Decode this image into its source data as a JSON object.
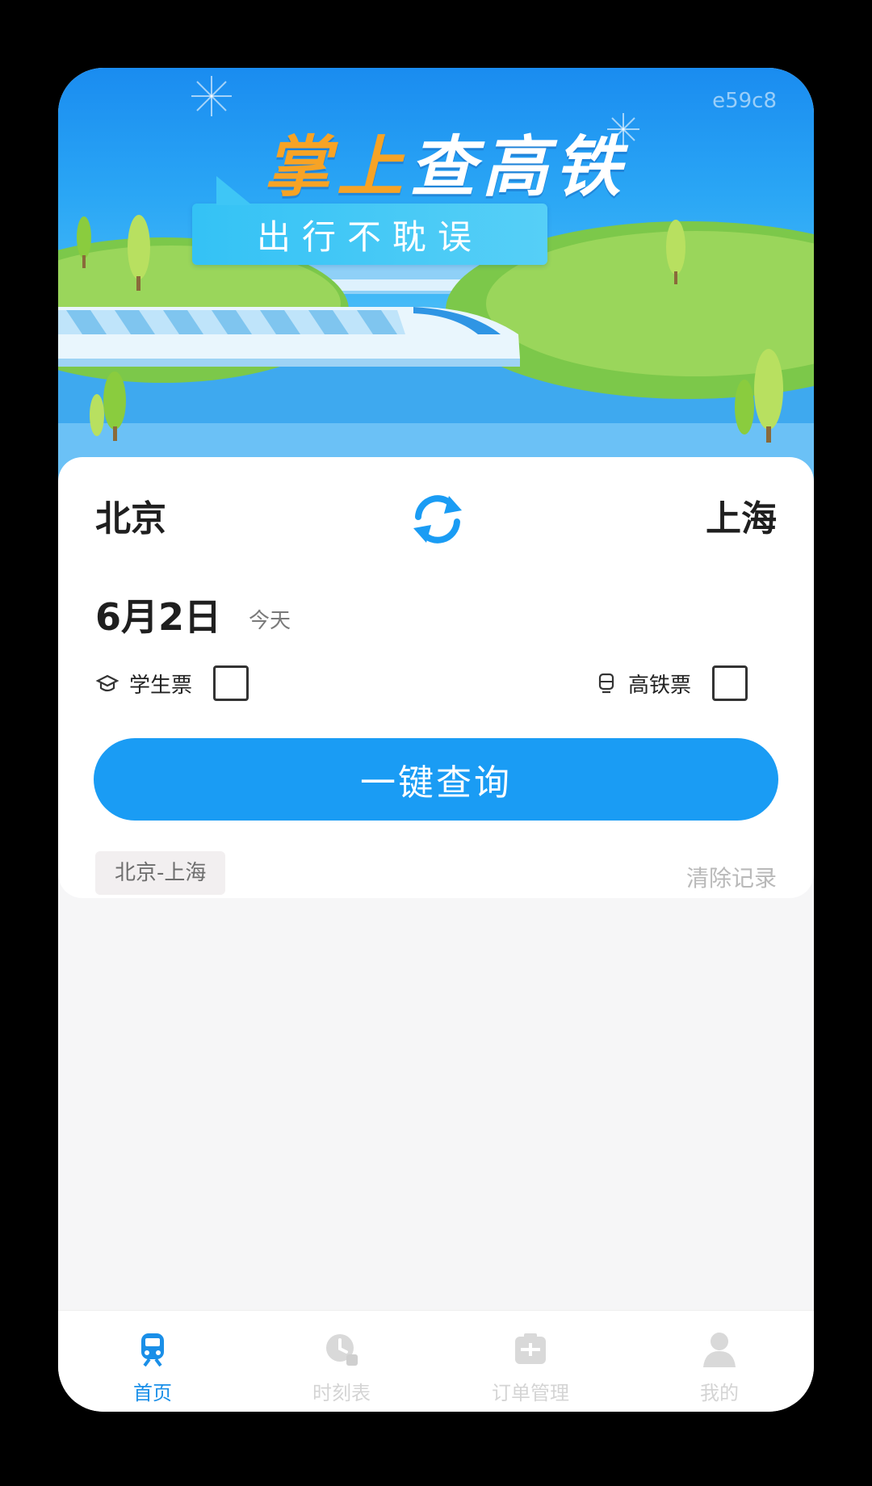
{
  "banner": {
    "title_part1": "掌上",
    "title_part2": "查高铁",
    "subtitle": "出行不耽误",
    "watermark": "e59c8"
  },
  "search": {
    "from_city": "北京",
    "to_city": "上海",
    "date": "6月2日",
    "date_hint": "今天",
    "student_ticket_label": "学生票",
    "student_ticket_checked": false,
    "hsr_ticket_label": "高铁票",
    "hsr_ticket_checked": false,
    "search_button": "一键查询",
    "history": [
      "北京-上海"
    ],
    "clear_history": "清除记录"
  },
  "tabbar": {
    "items": [
      {
        "label": "首页",
        "icon": "train-icon",
        "active": true
      },
      {
        "label": "时刻表",
        "icon": "clock-icon",
        "active": false
      },
      {
        "label": "订单管理",
        "icon": "order-icon",
        "active": false
      },
      {
        "label": "我的",
        "icon": "profile-icon",
        "active": false
      }
    ]
  },
  "colors": {
    "accent": "#1a9cf4",
    "title_highlight": "#f7a325",
    "tab_active": "#1a8fe8",
    "tab_inactive": "#d4d4d4"
  }
}
